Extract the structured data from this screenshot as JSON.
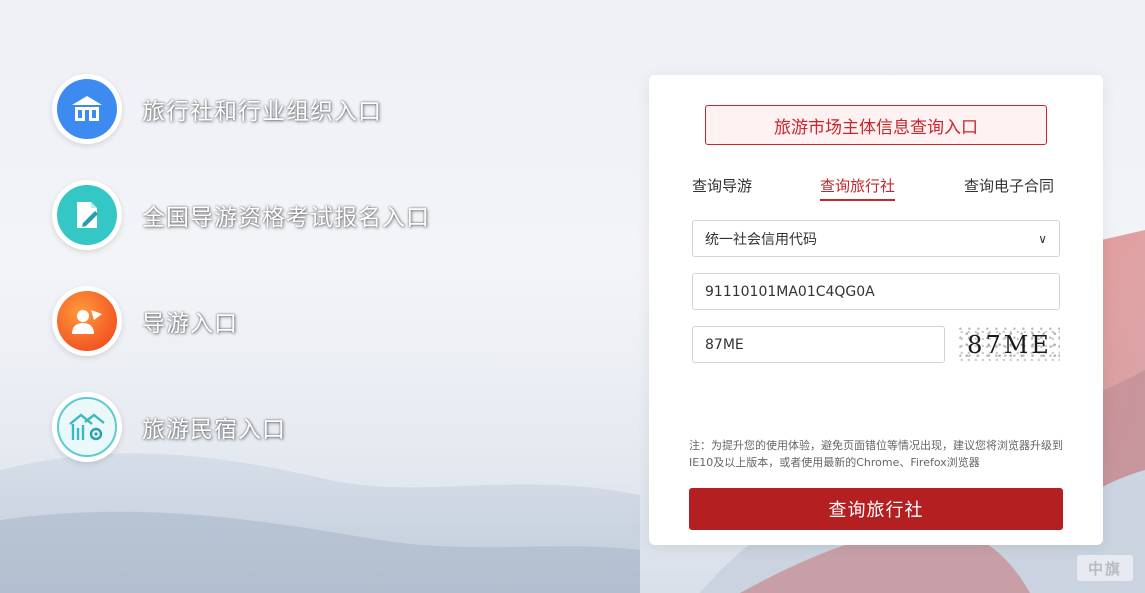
{
  "entries": [
    {
      "label": "旅行社和行业组织入口",
      "icon": "building-icon",
      "color": "#3d8bf0"
    },
    {
      "label": "全国导游资格考试报名入口",
      "icon": "document-edit-icon",
      "color": "#35c6c6"
    },
    {
      "label": "导游入口",
      "icon": "tour-guide-icon",
      "color": "#f05a22"
    },
    {
      "label": "旅游民宿入口",
      "icon": "homestay-icon",
      "color": "#5ccbd3"
    }
  ],
  "card": {
    "title": "旅游市场主体信息查询入口",
    "tabs": [
      "查询导游",
      "查询旅行社",
      "查询电子合同"
    ],
    "active_tab": "查询旅行社",
    "select_value": "统一社会信用代码",
    "code_value": "91110101MA01C4QG0A",
    "captcha_value": "87ME",
    "captcha_image_text": "87ME",
    "note": "注：为提升您的使用体验，避免页面错位等情况出现，建议您将浏览器升级到IE10及以上版本，或者使用最新的Chrome、Firefox浏览器",
    "submit_label": "查询旅行社"
  },
  "corner_badge": "中旗",
  "colors": {
    "accent": "#c8252c",
    "submit": "#b41f22"
  }
}
